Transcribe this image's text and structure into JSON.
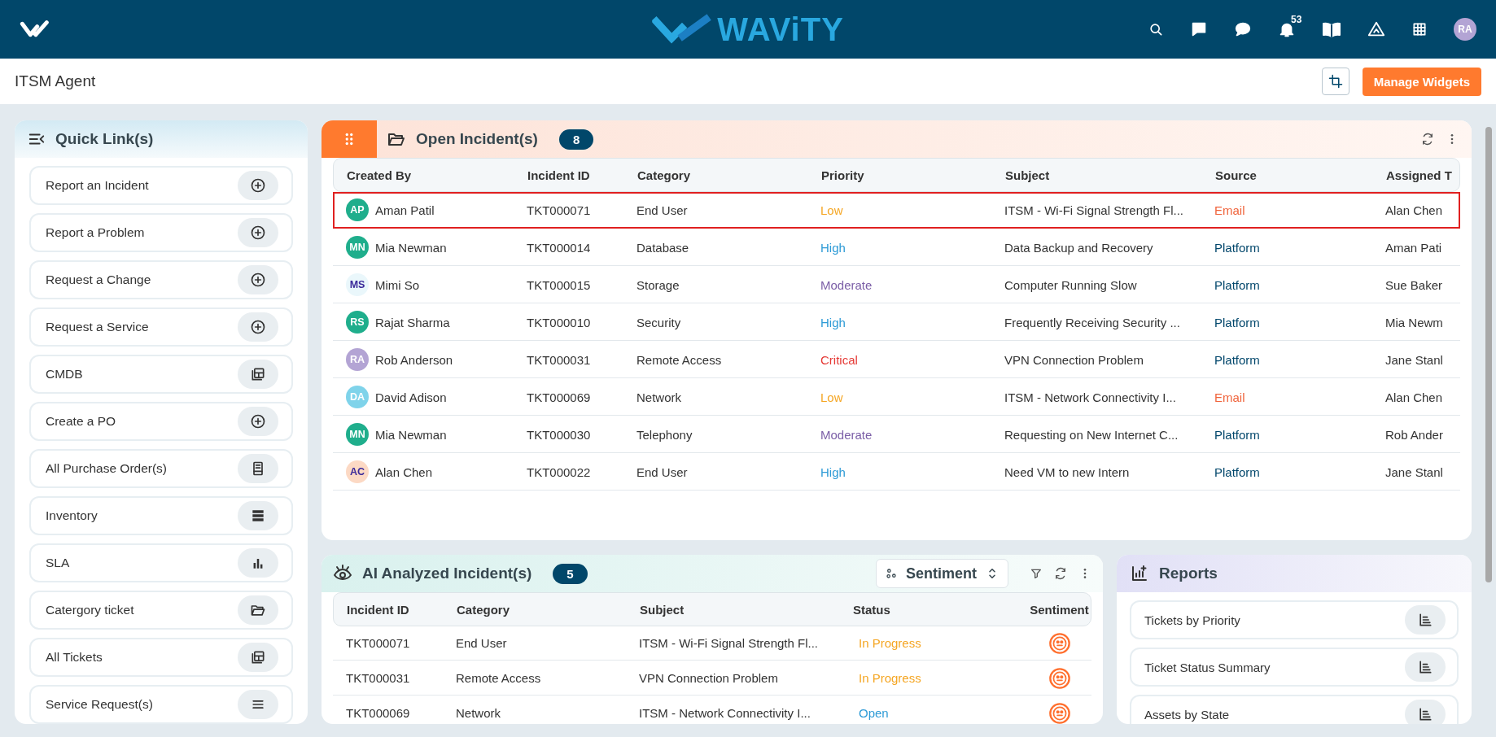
{
  "header": {
    "brand": "WAViTY",
    "notification_count": "53",
    "user_initials": "RA"
  },
  "page": {
    "title": "ITSM Agent",
    "manage_button": "Manage Widgets"
  },
  "quick_links": {
    "title": "Quick Link(s)",
    "items": [
      {
        "label": "Report an Incident",
        "kind": "plus"
      },
      {
        "label": "Report a Problem",
        "kind": "plus"
      },
      {
        "label": "Request a Change",
        "kind": "plus"
      },
      {
        "label": "Request a Service",
        "kind": "plus"
      },
      {
        "label": "CMDB",
        "kind": "layout"
      },
      {
        "label": "Create a PO",
        "kind": "plus"
      },
      {
        "label": "All Purchase Order(s)",
        "kind": "document"
      },
      {
        "label": "Inventory",
        "kind": "list"
      },
      {
        "label": "SLA",
        "kind": "bars"
      },
      {
        "label": "Catergory ticket",
        "kind": "folder"
      },
      {
        "label": "All Tickets",
        "kind": "layout"
      },
      {
        "label": "Service Request(s)",
        "kind": "menu"
      }
    ]
  },
  "open_incidents": {
    "title": "Open Incident(s)",
    "count": "8",
    "columns": [
      "Created By",
      "Incident ID",
      "Category",
      "Priority",
      "Subject",
      "Source",
      "Assigned T"
    ],
    "rows": [
      {
        "selected": true,
        "avatar": {
          "initials": "AP",
          "color": "#1fae8c"
        },
        "created_by": "Aman Patil",
        "id": "TKT000071",
        "category": "End User",
        "priority": {
          "text": "Low",
          "color": "#f5a623"
        },
        "subject": "ITSM - Wi-Fi Signal Strength Fl...",
        "source": {
          "text": "Email",
          "color": "#f0643c"
        },
        "assigned": "Alan Chen"
      },
      {
        "selected": false,
        "avatar": {
          "initials": "MN",
          "color": "#1fae8c"
        },
        "created_by": "Mia Newman",
        "id": "TKT000014",
        "category": "Database",
        "priority": {
          "text": "High",
          "color": "#2e9bd6"
        },
        "subject": "Data Backup and Recovery",
        "source": {
          "text": "Platform",
          "color": "#00466b"
        },
        "assigned": "Aman Pati"
      },
      {
        "selected": false,
        "avatar": {
          "initials": "MS",
          "color": "#eaf7fb"
        },
        "created_by": "Mimi So",
        "id": "TKT000015",
        "category": "Storage",
        "priority": {
          "text": "Moderate",
          "color": "#7b5ea7"
        },
        "subject": "Computer Running Slow",
        "source": {
          "text": "Platform",
          "color": "#00466b"
        },
        "assigned": "Sue Baker"
      },
      {
        "selected": false,
        "avatar": {
          "initials": "RS",
          "color": "#1fae8c"
        },
        "created_by": "Rajat Sharma",
        "id": "TKT000010",
        "category": "Security",
        "priority": {
          "text": "High",
          "color": "#2e9bd6"
        },
        "subject": "Frequently Receiving Security ...",
        "source": {
          "text": "Platform",
          "color": "#00466b"
        },
        "assigned": "Mia Newm"
      },
      {
        "selected": false,
        "avatar": {
          "initials": "RA",
          "color": "#b3a4d4"
        },
        "created_by": "Rob Anderson",
        "id": "TKT000031",
        "category": "Remote Access",
        "priority": {
          "text": "Critical",
          "color": "#e53935"
        },
        "subject": "VPN Connection Problem",
        "source": {
          "text": "Platform",
          "color": "#00466b"
        },
        "assigned": "Jane Stanl"
      },
      {
        "selected": false,
        "avatar": {
          "initials": "DA",
          "color": "#7fd3ea"
        },
        "created_by": "David Adison",
        "id": "TKT000069",
        "category": "Network",
        "priority": {
          "text": "Low",
          "color": "#f5a623"
        },
        "subject": "ITSM - Network Connectivity I...",
        "source": {
          "text": "Email",
          "color": "#f0643c"
        },
        "assigned": "Alan Chen"
      },
      {
        "selected": false,
        "avatar": {
          "initials": "MN",
          "color": "#1fae8c"
        },
        "created_by": "Mia Newman",
        "id": "TKT000030",
        "category": "Telephony",
        "priority": {
          "text": "Moderate",
          "color": "#7b5ea7"
        },
        "subject": "Requesting on New Internet C...",
        "source": {
          "text": "Platform",
          "color": "#00466b"
        },
        "assigned": "Rob Ander"
      },
      {
        "selected": false,
        "avatar": {
          "initials": "AC",
          "color": "#fcd9c4"
        },
        "created_by": "Alan Chen",
        "id": "TKT000022",
        "category": "End User",
        "priority": {
          "text": "High",
          "color": "#2e9bd6"
        },
        "subject": "Need VM to new Intern",
        "source": {
          "text": "Platform",
          "color": "#00466b"
        },
        "assigned": "Jane Stanl"
      }
    ]
  },
  "ai_incidents": {
    "title": "AI Analyzed Incident(s)",
    "count": "5",
    "sort_select": "Sentiment",
    "columns": [
      "Incident ID",
      "Category",
      "Subject",
      "Status",
      "Sentiment"
    ],
    "rows": [
      {
        "id": "TKT000071",
        "category": "End User",
        "subject": "ITSM - Wi-Fi Signal Strength Fl...",
        "status": {
          "text": "In Progress",
          "color": "#f5a623"
        }
      },
      {
        "id": "TKT000031",
        "category": "Remote Access",
        "subject": "VPN Connection Problem",
        "status": {
          "text": "In Progress",
          "color": "#f5a623"
        }
      },
      {
        "id": "TKT000069",
        "category": "Network",
        "subject": "ITSM - Network Connectivity I...",
        "status": {
          "text": "Open",
          "color": "#2e9bd6"
        }
      }
    ]
  },
  "reports": {
    "title": "Reports",
    "items": [
      "Tickets by Priority",
      "Ticket Status Summary",
      "Assets by State"
    ]
  }
}
